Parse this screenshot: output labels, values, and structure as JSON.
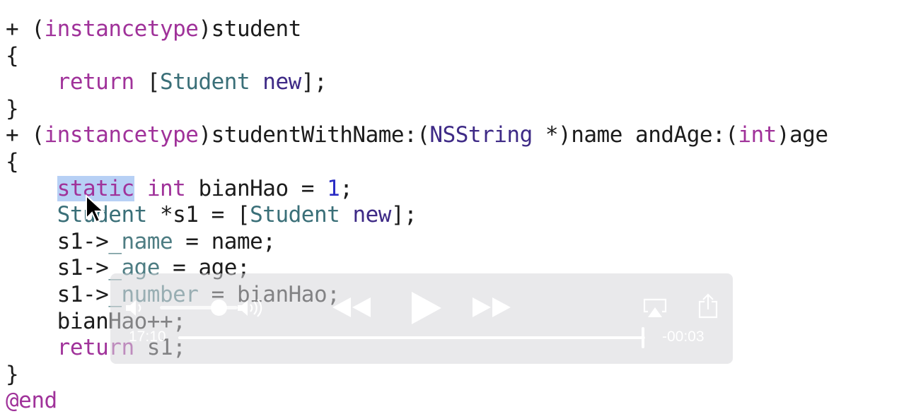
{
  "code": {
    "lines": [
      [
        {
          "t": "+ (",
          "c": "plain"
        },
        {
          "t": "instancetype",
          "c": "kw"
        },
        {
          "t": ")student",
          "c": "plain"
        }
      ],
      [
        {
          "t": "{",
          "c": "plain"
        }
      ],
      [
        {
          "t": "    ",
          "c": "plain"
        },
        {
          "t": "return",
          "c": "kw"
        },
        {
          "t": " [",
          "c": "plain"
        },
        {
          "t": "Student",
          "c": "type"
        },
        {
          "t": " ",
          "c": "plain"
        },
        {
          "t": "new",
          "c": "meth"
        },
        {
          "t": "];",
          "c": "plain"
        }
      ],
      [
        {
          "t": "}",
          "c": "plain"
        }
      ],
      [
        {
          "t": "+ (",
          "c": "plain"
        },
        {
          "t": "instancetype",
          "c": "kw"
        },
        {
          "t": ")studentWithName:(",
          "c": "plain"
        },
        {
          "t": "NSString",
          "c": "meth"
        },
        {
          "t": " *)name andAge:(",
          "c": "plain"
        },
        {
          "t": "int",
          "c": "kw"
        },
        {
          "t": ")age",
          "c": "plain"
        }
      ],
      [
        {
          "t": "{",
          "c": "plain"
        }
      ],
      [
        {
          "t": "    ",
          "c": "plain"
        },
        {
          "t": "static",
          "c": "sel"
        },
        {
          "t": " ",
          "c": "plain"
        },
        {
          "t": "int",
          "c": "kw"
        },
        {
          "t": " bianHao = ",
          "c": "plain"
        },
        {
          "t": "1",
          "c": "num"
        },
        {
          "t": ";",
          "c": "plain"
        }
      ],
      [
        {
          "t": "    ",
          "c": "plain"
        },
        {
          "t": "Student",
          "c": "type"
        },
        {
          "t": " *s1 = [",
          "c": "plain"
        },
        {
          "t": "Student",
          "c": "type"
        },
        {
          "t": " ",
          "c": "plain"
        },
        {
          "t": "new",
          "c": "meth"
        },
        {
          "t": "];",
          "c": "plain"
        }
      ],
      [
        {
          "t": "    s1->",
          "c": "plain"
        },
        {
          "t": "_name",
          "c": "ivar"
        },
        {
          "t": " = name;",
          "c": "plain"
        }
      ],
      [
        {
          "t": "    s1->",
          "c": "plain"
        },
        {
          "t": "_age",
          "c": "ivar"
        },
        {
          "t": " = age;",
          "c": "plain"
        }
      ],
      [
        {
          "t": "    s1->",
          "c": "plain"
        },
        {
          "t": "_number",
          "c": "ivar"
        },
        {
          "t": " = bianHao;",
          "c": "plain"
        }
      ],
      [
        {
          "t": "    bianHao++;",
          "c": "plain"
        }
      ],
      [
        {
          "t": "    ",
          "c": "plain"
        },
        {
          "t": "return",
          "c": "kw"
        },
        {
          "t": " s1;",
          "c": "plain"
        }
      ],
      [
        {
          "t": "}",
          "c": "plain"
        }
      ],
      [
        {
          "t": "@end",
          "c": "kw"
        }
      ]
    ]
  },
  "player": {
    "elapsed": "17:10",
    "remaining": "-00:03",
    "progress": 0.995,
    "volume": 0.75,
    "icons": [
      "volume-low-icon",
      "volume-high-icon",
      "rewind-icon",
      "play-icon",
      "fast-forward-icon",
      "airplay-icon",
      "share-icon"
    ]
  }
}
